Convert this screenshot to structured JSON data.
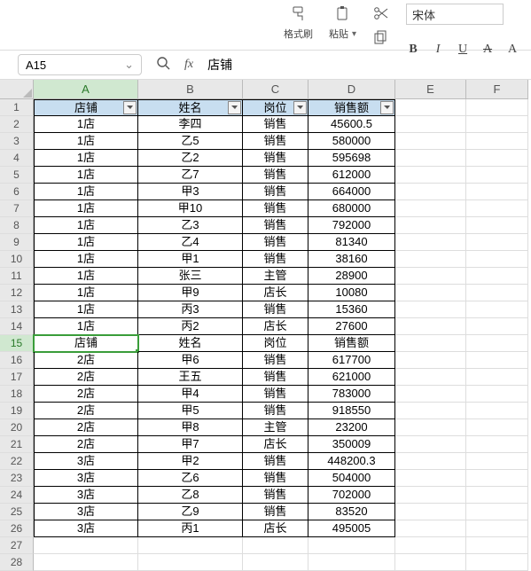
{
  "toolbar": {
    "format_painter": "格式刷",
    "paste": "粘贴",
    "font_name": "宋体",
    "bold": "B",
    "italic": "I",
    "underline": "U",
    "strike": "A",
    "more": "A"
  },
  "refbar": {
    "cell_ref": "A15",
    "fx": "fx",
    "formula_value": "店铺"
  },
  "columns": [
    "A",
    "B",
    "C",
    "D",
    "E",
    "F"
  ],
  "active_col_index": 0,
  "active_row_index": 14,
  "row_count": 28,
  "table": {
    "header_rows": [
      0,
      14
    ],
    "rows": [
      {
        "a": "店铺",
        "b": "姓名",
        "c": "岗位",
        "d": "销售额"
      },
      {
        "a": "1店",
        "b": "李四",
        "c": "销售",
        "d": "45600.5"
      },
      {
        "a": "1店",
        "b": "乙5",
        "c": "销售",
        "d": "580000"
      },
      {
        "a": "1店",
        "b": "乙2",
        "c": "销售",
        "d": "595698"
      },
      {
        "a": "1店",
        "b": "乙7",
        "c": "销售",
        "d": "612000"
      },
      {
        "a": "1店",
        "b": "甲3",
        "c": "销售",
        "d": "664000"
      },
      {
        "a": "1店",
        "b": "甲10",
        "c": "销售",
        "d": "680000"
      },
      {
        "a": "1店",
        "b": "乙3",
        "c": "销售",
        "d": "792000"
      },
      {
        "a": "1店",
        "b": "乙4",
        "c": "销售",
        "d": "81340"
      },
      {
        "a": "1店",
        "b": "甲1",
        "c": "销售",
        "d": "38160"
      },
      {
        "a": "1店",
        "b": "张三",
        "c": "主管",
        "d": "28900"
      },
      {
        "a": "1店",
        "b": "甲9",
        "c": "店长",
        "d": "10080"
      },
      {
        "a": "1店",
        "b": "丙3",
        "c": "销售",
        "d": "15360"
      },
      {
        "a": "1店",
        "b": "丙2",
        "c": "店长",
        "d": "27600"
      },
      {
        "a": "店铺",
        "b": "姓名",
        "c": "岗位",
        "d": "销售额"
      },
      {
        "a": "2店",
        "b": "甲6",
        "c": "销售",
        "d": "617700"
      },
      {
        "a": "2店",
        "b": "王五",
        "c": "销售",
        "d": "621000"
      },
      {
        "a": "2店",
        "b": "甲4",
        "c": "销售",
        "d": "783000"
      },
      {
        "a": "2店",
        "b": "甲5",
        "c": "销售",
        "d": "918550"
      },
      {
        "a": "2店",
        "b": "甲8",
        "c": "主管",
        "d": "23200"
      },
      {
        "a": "2店",
        "b": "甲7",
        "c": "店长",
        "d": "350009"
      },
      {
        "a": "3店",
        "b": "甲2",
        "c": "销售",
        "d": "448200.3"
      },
      {
        "a": "3店",
        "b": "乙6",
        "c": "销售",
        "d": "504000"
      },
      {
        "a": "3店",
        "b": "乙8",
        "c": "销售",
        "d": "702000"
      },
      {
        "a": "3店",
        "b": "乙9",
        "c": "销售",
        "d": "83520"
      },
      {
        "a": "3店",
        "b": "丙1",
        "c": "店长",
        "d": "495005"
      }
    ]
  }
}
